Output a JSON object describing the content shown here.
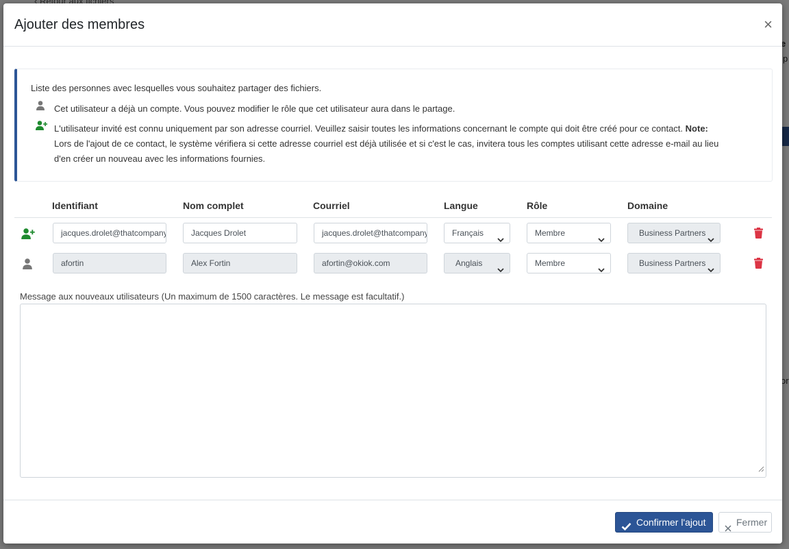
{
  "background": {
    "back_link": "Retour aux fichiers",
    "fragments": [
      "e",
      "p",
      "ve",
      "or"
    ]
  },
  "modal": {
    "title": "Ajouter des membres",
    "close_glyph": "×"
  },
  "info": {
    "intro": "Liste des personnes avec lesquelles vous souhaitez partager des fichiers.",
    "existing_user_text": "Cet utilisateur a déjà un compte. Vous pouvez modifier le rôle que cet utilisateur aura dans le partage.",
    "new_user_text_1": "L'utilisateur invité est connu uniquement par son adresse courriel. Veuillez saisir toutes les informations concernant le compte qui doit être créé pour ce contact.",
    "note_label": "Note:",
    "new_user_text_2": "Lors de l'ajout de ce contact, le système vérifiera si cette adresse courriel est déjà utilisée et si c'est le cas, invitera tous les comptes utilisant cette adresse e-mail au lieu d'en créer un nouveau avec les informations fournies."
  },
  "table": {
    "headers": [
      "Identifiant",
      "Nom complet",
      "Courriel",
      "Langue",
      "Rôle",
      "Domaine"
    ],
    "rows": [
      {
        "type_icon": "user-plus-icon",
        "identifier": "jacques.drolet@thatcompany.com",
        "full_name": "Jacques Drolet",
        "email": "jacques.drolet@thatcompany.com",
        "language": "Français",
        "role": "Membre",
        "domain": "Business Partners"
      },
      {
        "type_icon": "user-icon",
        "identifier": "afortin",
        "full_name": "Alex Fortin",
        "email": "afortin@okiok.com",
        "language": "Anglais",
        "role": "Membre",
        "domain": "Business Partners"
      }
    ]
  },
  "message": {
    "label": "Message aux nouveaux utilisateurs (Un maximum de 1500 caractères. Le message est facultatif.)",
    "value": ""
  },
  "footer": {
    "confirm_label": "Confirmer l'ajout",
    "close_label": "Fermer"
  },
  "colors": {
    "primary": "#2c5596",
    "success_icon": "#1e8a2e",
    "danger": "#dc3545",
    "muted_icon": "#777777"
  }
}
